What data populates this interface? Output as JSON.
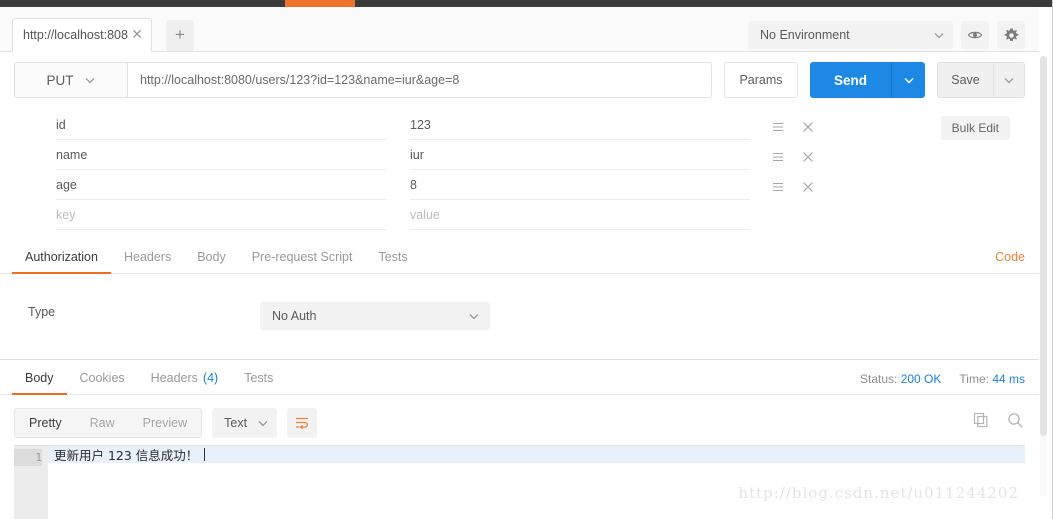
{
  "window": {
    "accent_color": "#f0722c",
    "topbar_color": "#3b3b3b"
  },
  "tabbar": {
    "request_tab_label": "http://localhost:808",
    "close_icon": "close-icon",
    "new_tab_label": "+"
  },
  "environment": {
    "selected": "No Environment",
    "eye_icon": "eye-icon",
    "gear_icon": "gear-icon"
  },
  "request": {
    "method": "PUT",
    "url": "http://localhost:8080/users/123?id=123&name=iur&age=8",
    "params_label": "Params",
    "send_label": "Send",
    "save_label": "Save",
    "send_color": "#1e88e5"
  },
  "params": {
    "bulk_edit_label": "Bulk Edit",
    "key_placeholder": "key",
    "value_placeholder": "value",
    "rows": [
      {
        "key": "id",
        "value": "123"
      },
      {
        "key": "name",
        "value": "iur"
      },
      {
        "key": "age",
        "value": "8"
      }
    ]
  },
  "request_tabs": {
    "items": [
      {
        "label": "Authorization",
        "active": true
      },
      {
        "label": "Headers",
        "active": false
      },
      {
        "label": "Body",
        "active": false
      },
      {
        "label": "Pre-request Script",
        "active": false
      },
      {
        "label": "Tests",
        "active": false
      }
    ],
    "code_link": "Code",
    "code_color": "#e8833a"
  },
  "auth": {
    "type_label": "Type",
    "selected_type": "No Auth"
  },
  "response_tabs": {
    "items": [
      {
        "label": "Body",
        "active": true
      },
      {
        "label": "Cookies",
        "active": false
      },
      {
        "label": "Headers",
        "count": "(4)",
        "active": false
      },
      {
        "label": "Tests",
        "active": false
      }
    ]
  },
  "response_status": {
    "status_label": "Status:",
    "status_value": "200 OK",
    "time_label": "Time:",
    "time_value": "44 ms",
    "value_color": "#2080d0"
  },
  "body_toolbar": {
    "views": [
      {
        "label": "Pretty",
        "active": true
      },
      {
        "label": "Raw",
        "active": false
      },
      {
        "label": "Preview",
        "active": false
      }
    ],
    "format": "Text",
    "wrap_icon": "word-wrap-icon",
    "copy_icon": "copy-icon",
    "search_icon": "search-icon"
  },
  "response_body": {
    "line_number": "1",
    "content": "更新用户 123 信息成功！"
  },
  "watermark": "http://blog.csdn.net/u011244202"
}
